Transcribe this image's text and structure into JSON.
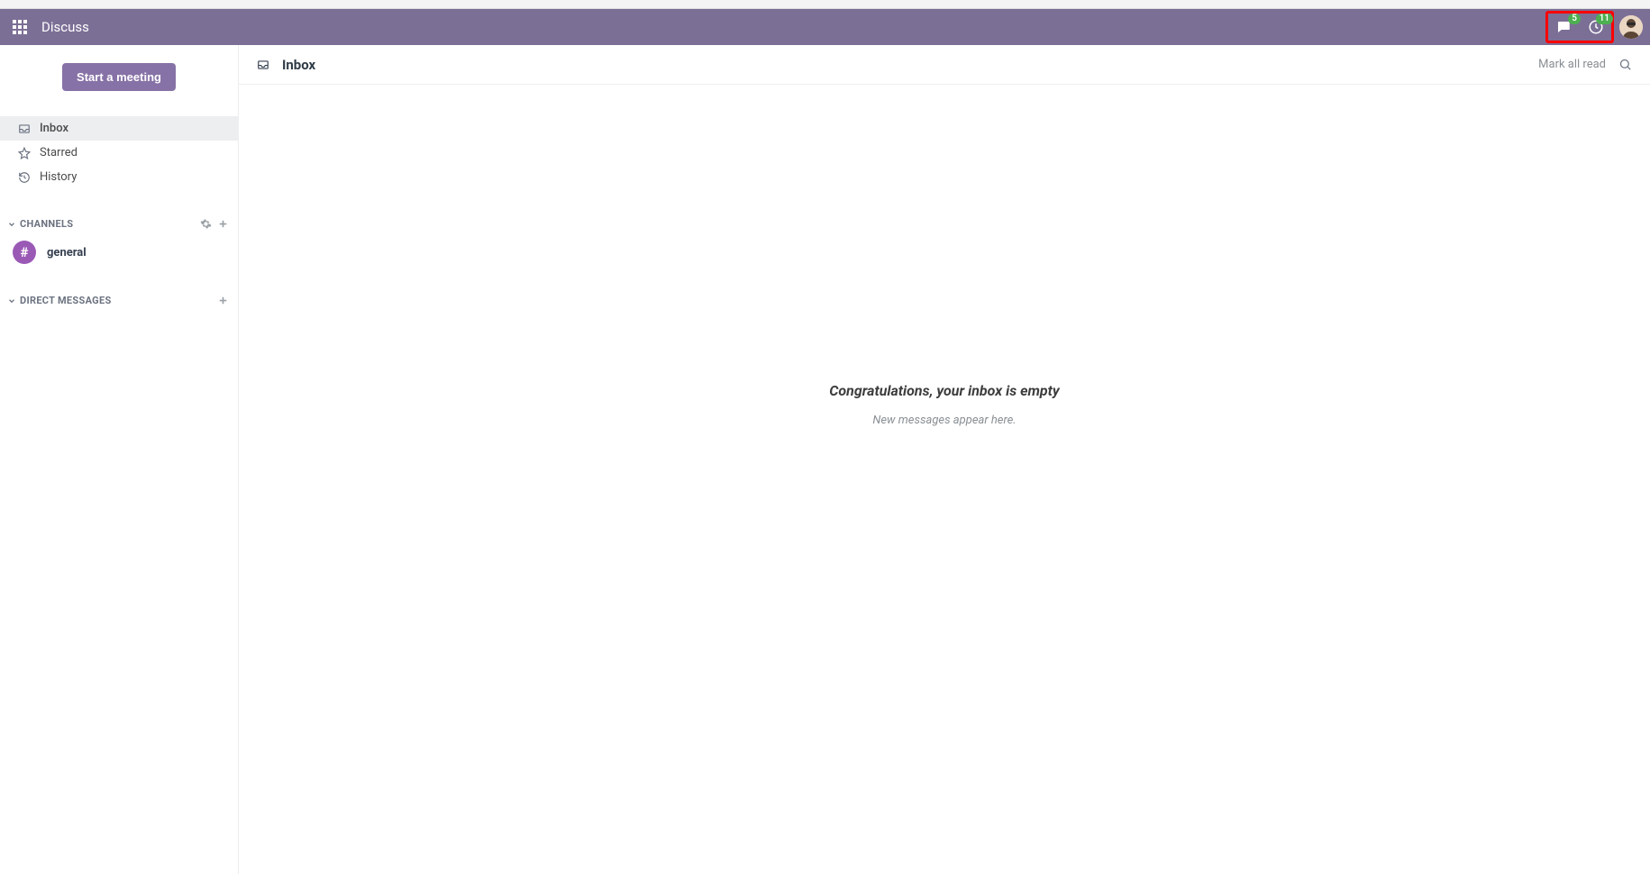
{
  "topbar": {
    "app_title": "Discuss",
    "messages_badge": "5",
    "activities_badge": "11"
  },
  "sidebar": {
    "start_meeting_label": "Start a meeting",
    "mailboxes": [
      {
        "key": "inbox",
        "label": "Inbox"
      },
      {
        "key": "starred",
        "label": "Starred"
      },
      {
        "key": "history",
        "label": "History"
      }
    ],
    "channels_section_label": "CHANNELS",
    "dm_section_label": "DIRECT MESSAGES",
    "channels": [
      {
        "symbol": "#",
        "name": "general"
      }
    ]
  },
  "content": {
    "header_title": "Inbox",
    "mark_all_read_label": "Mark all read",
    "empty_title": "Congratulations, your inbox is empty",
    "empty_subtitle": "New messages appear here."
  }
}
